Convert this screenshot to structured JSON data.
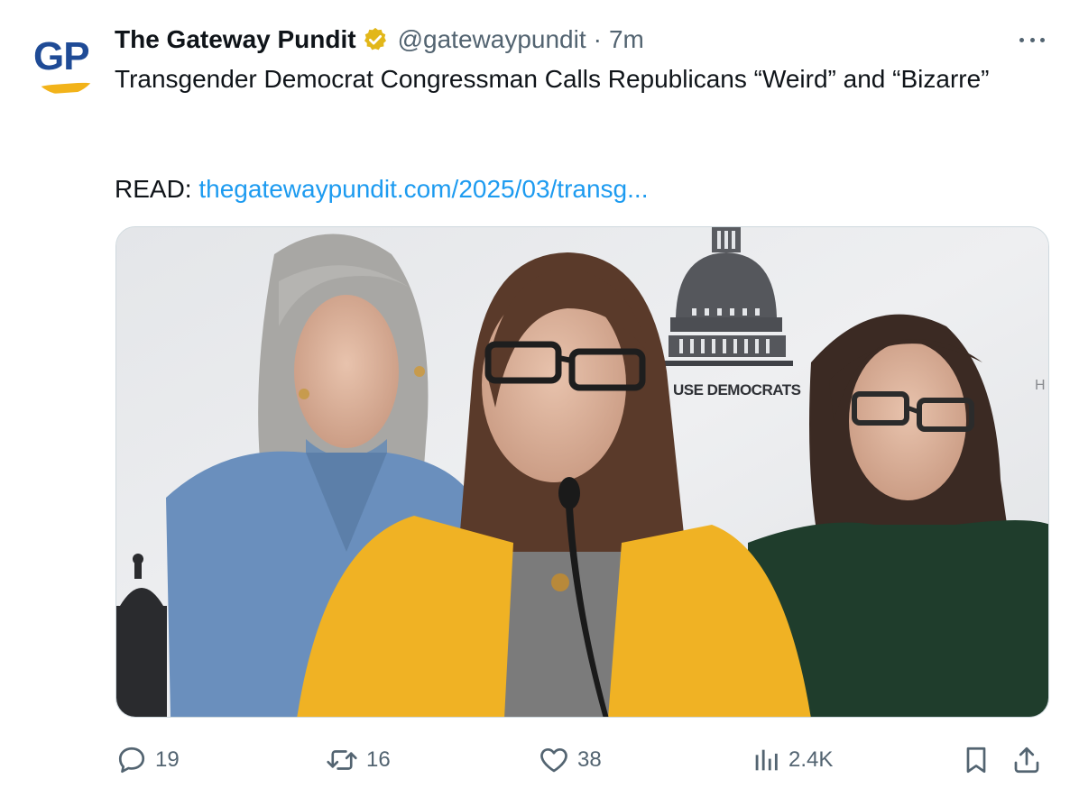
{
  "author": {
    "avatar_text": "GP",
    "display_name": "The Gateway Pundit",
    "handle": "@gatewaypundit",
    "separator": "·",
    "time": "7m",
    "verified_badge": "gold-check-badge"
  },
  "tweet": {
    "text": "Transgender Democrat Congressman Calls Republicans “Weird” and “Bizarre”",
    "read_label": "READ:",
    "link_text": "thegatewaypundit.com/2025/03/transg..."
  },
  "media": {
    "backdrop_text": "USE DEMOCRATS",
    "backdrop_edge_text": "H"
  },
  "actions": {
    "replies": "19",
    "reposts": "16",
    "likes": "38",
    "views": "2.4K"
  },
  "colors": {
    "link": "#1d9bf0",
    "muted": "#536471",
    "verified_gold": "#e2b719",
    "brand_blue": "#1f4b96",
    "brand_yellow": "#f2b31a"
  }
}
